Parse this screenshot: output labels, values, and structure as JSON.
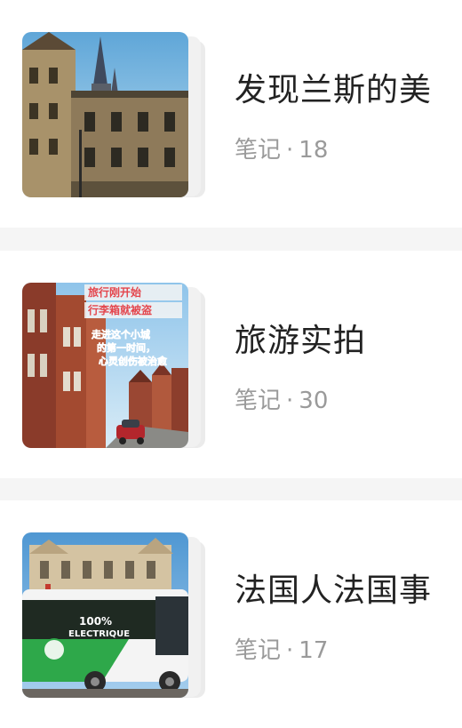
{
  "notebooks": [
    {
      "title": "发现兰斯的美",
      "notes_label": "笔记",
      "separator": "·",
      "count": "18"
    },
    {
      "title": "旅游实拍",
      "notes_label": "笔记",
      "separator": "·",
      "count": "30",
      "cover_text": {
        "line1": "旅行刚开始",
        "line2": "行李箱就被盗",
        "line3": "走进这个小城",
        "line4": "的第一时间，",
        "line5": "心灵创伤被治愈"
      }
    },
    {
      "title": "法国人法国事",
      "notes_label": "笔记",
      "separator": "·",
      "count": "17",
      "cover_text": {
        "bus_line1": "100%",
        "bus_line2": "ELECTRIQUE"
      }
    }
  ]
}
